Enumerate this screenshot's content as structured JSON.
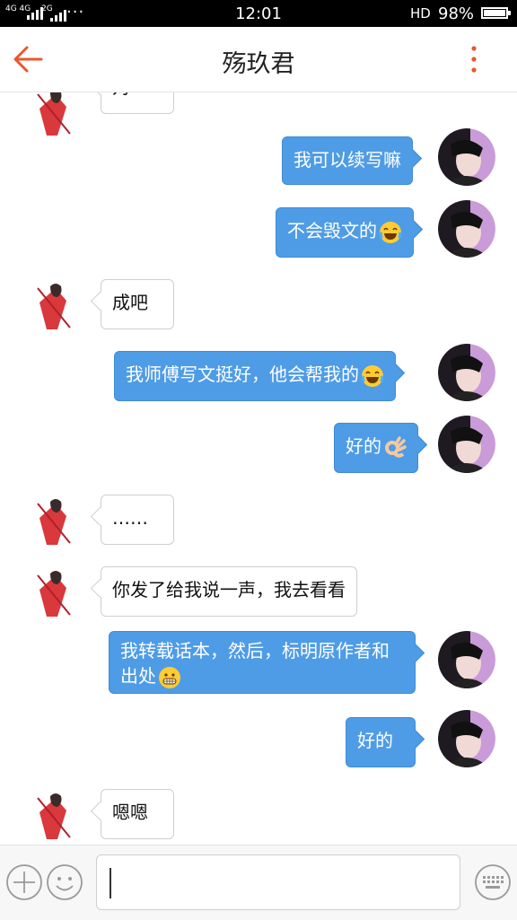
{
  "status_bar": {
    "signal_1": "4G 4G",
    "signal_2": "2G",
    "dots": "···",
    "time": "12:01",
    "hd": "HD",
    "battery_pct": "98%",
    "battery_level": 0.98
  },
  "header": {
    "title": "殇玖君",
    "back_icon": "back-arrow-icon",
    "more_icon": "more-vertical-icon"
  },
  "colors": {
    "accent": "#e8582e",
    "outgoing_bubble": "#4f9ce6"
  },
  "messages": [
    {
      "side": "in",
      "text": "对"
    },
    {
      "side": "out",
      "text": "我可以续写嘛"
    },
    {
      "side": "out",
      "text": "不会毁文的",
      "emoji": "laughing-tears-emoji"
    },
    {
      "side": "in",
      "text": "成吧"
    },
    {
      "side": "out",
      "text": "我师傅写文挺好，他会帮我的",
      "emoji": "laughing-tears-emoji"
    },
    {
      "side": "out",
      "text": "好的",
      "emoji": "ok-hand-emoji"
    },
    {
      "side": "in",
      "text": "……"
    },
    {
      "side": "in",
      "text": "你发了给我说一声，我去看看"
    },
    {
      "side": "out",
      "text": "我转载话本，然后，标明原作者和出处",
      "emoji": "grimacing-emoji"
    },
    {
      "side": "out",
      "text": "好的"
    },
    {
      "side": "in",
      "text": "嗯嗯"
    }
  ],
  "input_bar": {
    "plus_icon": "plus-circle-icon",
    "emoji_icon": "smiley-icon",
    "keyboard_icon": "keyboard-icon",
    "value": ""
  }
}
